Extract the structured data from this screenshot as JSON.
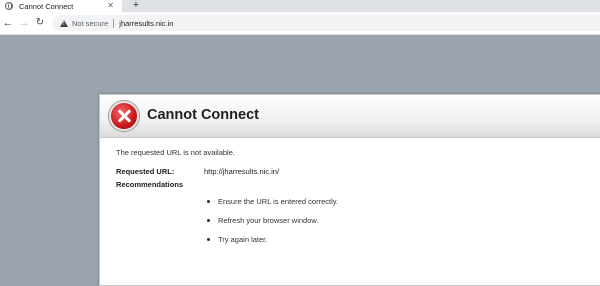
{
  "browser": {
    "tab": {
      "title": "Cannot Connect",
      "close_glyph": "✕",
      "favicon": "globe-icon"
    },
    "new_tab_glyph": "+",
    "toolbar": {
      "back_glyph": "←",
      "forward_glyph": "→",
      "reload_glyph": "↻",
      "security_label": "Not secure",
      "url": "jharresults.nic.in"
    }
  },
  "dialog": {
    "title": "Cannot Connect",
    "icon": "error-x-icon",
    "message": "The requested URL is not available.",
    "requested_url_label": "Requested URL:",
    "requested_url_value": "http://jharresults.nic.in/",
    "recommendations_label": "Recommendations",
    "recommendations": [
      "Ensure the URL is entered correctly.",
      "Refresh your browser window.",
      "Try again later."
    ]
  },
  "colors": {
    "page_background": "#9aa3ae",
    "error_red": "#c8171b"
  }
}
